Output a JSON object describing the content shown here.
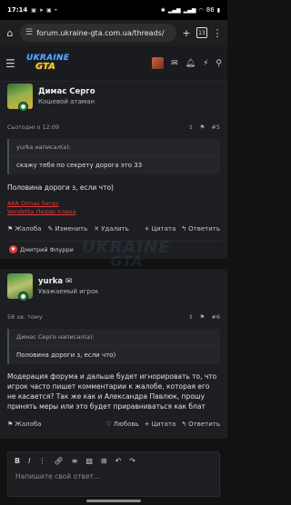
{
  "status_bar": {
    "time": "17:14",
    "battery": "86"
  },
  "browser": {
    "url": "forum.ukraine-gta.com.ua/threads/",
    "tab_count": "13"
  },
  "site": {
    "logo_top": "UKRAINE",
    "logo_bottom": "GTA"
  },
  "post1": {
    "author": "Димас Серго",
    "role": "Кошевой атаман",
    "time": "Сьогодні о 12:09",
    "number": "#5",
    "quote_header": "yurka написал(а):",
    "quote_text": "скажу тебя по секрету дорога это 33",
    "text": "Половина дороги з, если что)",
    "signature_line1": "AKA Dimas Sergo",
    "signature_line2": "Vendetta Лидер клана",
    "actions": {
      "complaint": "Жалоба",
      "edit": "Изменить",
      "delete": "Удалить",
      "quote": "Цитата",
      "reply": "Ответить"
    },
    "reaction": "Дмитрий Флурри"
  },
  "post2": {
    "author": "yurka",
    "role": "Уважаемый игрок",
    "time": "58 хв. тому",
    "number": "#6",
    "quote_header": "Димас Серго написал(а):",
    "quote_text": "Половина дороги з, если что)",
    "text": "Модерация форума и дальше будет игнорировать то, что игрок часто пишет комментарии к жалобе, которая его не касается? Так же как и Александра Павлюк, прошу принять меры или это будет приравниваться как блат",
    "actions": {
      "complaint": "Жалоба",
      "like": "Любовь",
      "quote": "Цитата",
      "reply": "Ответить"
    }
  },
  "editor": {
    "placeholder": "Напишите свой ответ..."
  },
  "watermark": {
    "line1": "UKRAINE",
    "line2": "GTA"
  },
  "colors": {
    "background": "#121212",
    "post_bg": "#1d1e21",
    "accent_red": "#e03a3a",
    "online_badge": "#1f8b3a"
  }
}
